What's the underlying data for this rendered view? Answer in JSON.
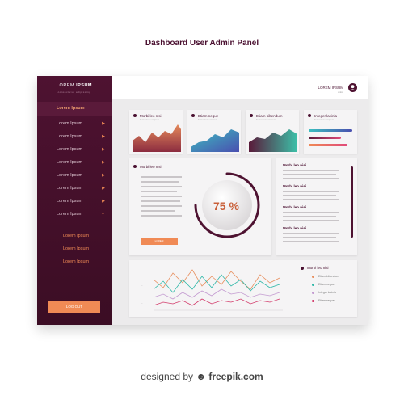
{
  "page": {
    "title": "Dashboard User Admin Panel"
  },
  "brand": {
    "word1": "LOREM",
    "word2": "IPSUM",
    "sub": "consectetur adipiscing"
  },
  "nav": {
    "active": "Lorem Ipsum",
    "items": [
      "Lorem Ipsum",
      "Lorem Ipsum",
      "Lorem Ipsum",
      "Lorem Ipsum",
      "Lorem Ipsum",
      "Lorem Ipsum",
      "Lorem Ipsum",
      "Lorem Ipsum"
    ],
    "sub_items": [
      "Lorem Ipsum",
      "Lorem Ipsum",
      "Lorem Ipsum"
    ],
    "logout": "LOG OUT"
  },
  "topbar": {
    "user_name": "LOREM IPSUM",
    "user_sub": "dolore"
  },
  "cards": {
    "c1": {
      "title": "Morbi leo nisi",
      "sub": "Fermentum vel ipsum"
    },
    "c2": {
      "title": "Etiam neque",
      "sub": "Fermentum vel ipsum"
    },
    "c3": {
      "title": "Etiam bibendum",
      "sub": "Fermentum vel ipsum"
    },
    "c4": {
      "title": "Integer lacinia",
      "sub": "Fermentum vel ipsum"
    }
  },
  "progress": {
    "title": "Morbi leo nisi",
    "value": "75 %",
    "fraction": 0.75,
    "button": "LOREM"
  },
  "side_list": {
    "titles": [
      "Morbi leo nisi",
      "Morbi leo nisi",
      "Morbi leo nisi",
      "Morbi leo nisi"
    ]
  },
  "line_chart": {
    "legend_title": "Morbi leo nisi",
    "legend": [
      "Etiam bibendum",
      "Etiam neque",
      "Integer lacinia",
      "Etiam neque"
    ],
    "colors": [
      "#e89060",
      "#2fb8a8",
      "#c39ad0",
      "#d23a6a"
    ]
  },
  "footer": {
    "text": "designed by",
    "brand": "freepik.com"
  },
  "colors": {
    "primary": "#4e1231",
    "accent": "#f08a55",
    "percent": "#c9603a"
  }
}
